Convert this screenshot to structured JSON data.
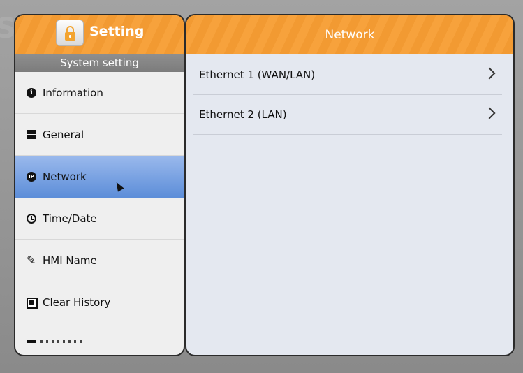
{
  "left_panel": {
    "title": "Setting",
    "section_header": "System setting",
    "items": [
      {
        "label": "Information",
        "icon": "info-icon"
      },
      {
        "label": "General",
        "icon": "grid-icon"
      },
      {
        "label": "Network",
        "icon": "ip-icon",
        "active": true
      },
      {
        "label": "Time/Date",
        "icon": "clock-icon"
      },
      {
        "label": "HMI Name",
        "icon": "pen-icon"
      },
      {
        "label": "Clear History",
        "icon": "clear-history-icon"
      }
    ]
  },
  "right_panel": {
    "title": "Network",
    "rows": [
      {
        "label": "Ethernet 1 (WAN/LAN)"
      },
      {
        "label": "Ethernet 2 (LAN)"
      }
    ]
  },
  "colors": {
    "header_orange": "#f39a30",
    "active_blue": "#6f9ce0",
    "panel_bg": "#e4e8f0"
  }
}
